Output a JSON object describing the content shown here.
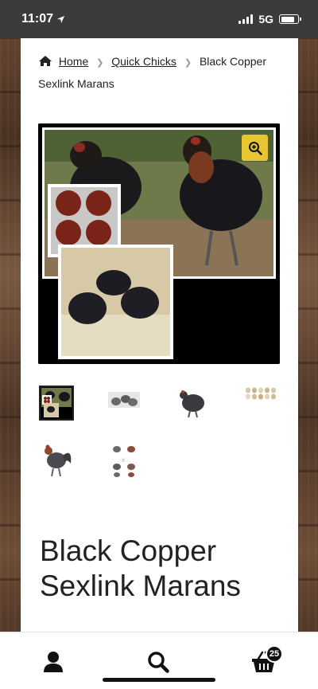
{
  "status_bar": {
    "time": "11:07",
    "network": "5G"
  },
  "breadcrumb": {
    "home": "Home",
    "category": "Quick Chicks",
    "current": "Black Copper Sexlink Marans"
  },
  "gallery": {
    "zoom_icon": "zoom-in-icon",
    "thumbnails": [
      {
        "name": "collage"
      },
      {
        "name": "chicks"
      },
      {
        "name": "hen"
      },
      {
        "name": "eggs"
      },
      {
        "name": "rooster"
      },
      {
        "name": "chart"
      }
    ]
  },
  "product": {
    "title": "Black Copper Sexlink Marans"
  },
  "bottom_nav": {
    "account_icon": "user-icon",
    "search_icon": "search-icon",
    "cart_icon": "basket-icon",
    "cart_count": "25"
  },
  "colors": {
    "accent": "#e8c531",
    "text": "#222222"
  }
}
